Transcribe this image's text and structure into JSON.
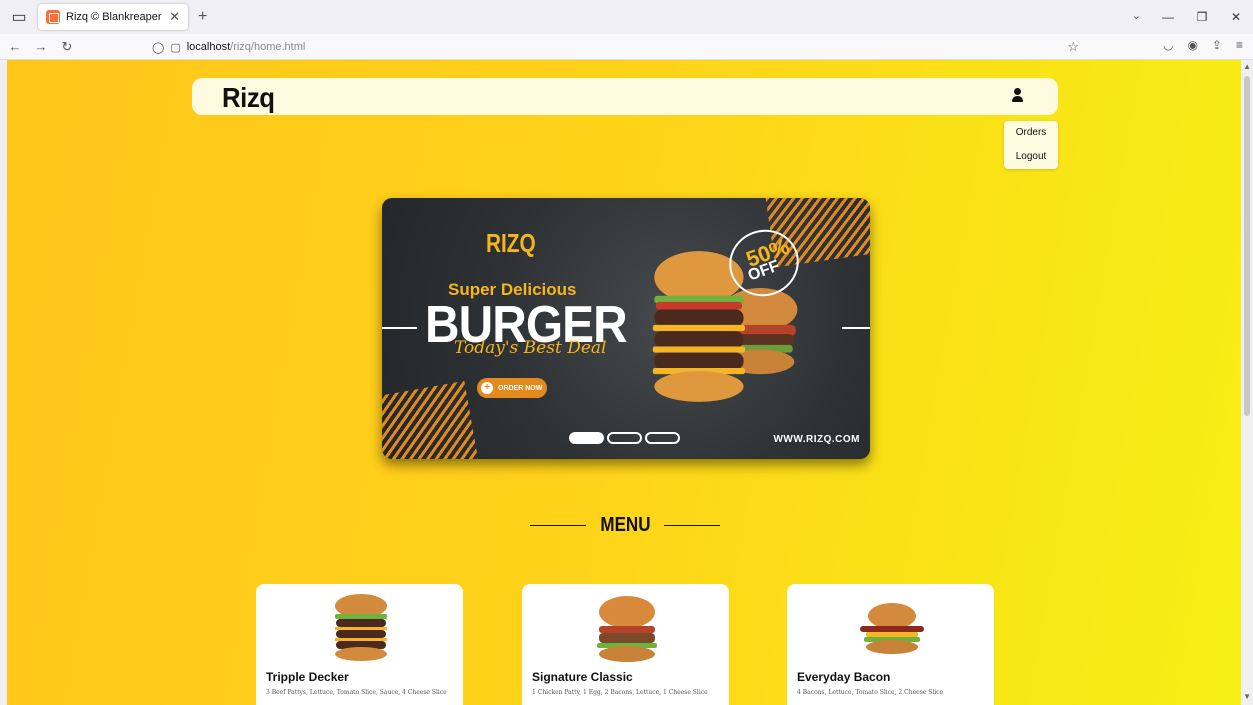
{
  "browser": {
    "tab_title": "Rizq © Blankreaper",
    "url_host": "localhost",
    "url_path": "/rizq/home.html"
  },
  "header": {
    "brand": "Rizq"
  },
  "user_menu": {
    "items": [
      "Orders",
      "Logout"
    ]
  },
  "banner": {
    "logo": "RIZQ",
    "tagline": "Super Delicious",
    "headline": "BURGER",
    "script": "Today's Best Deal",
    "cta": "ORDER NOW",
    "badge_pct": "50%",
    "badge_off": "OFF",
    "website": "WWW.RIZQ.COM",
    "active_slide": 1,
    "slides": 3
  },
  "menu": {
    "heading": "MENU",
    "items": [
      {
        "name": "Tripple Decker",
        "desc": "3 Beef Pattys, Lettuce, Tomato Slice, Sauce, 4 Cheese Slice"
      },
      {
        "name": "Signature Classic",
        "desc": "1 Chicken Patty, 1 Egg, 2 Bacons, Lettuce, 1 Cheese Slice"
      },
      {
        "name": "Everyday Bacon",
        "desc": "4 Bacons, Lettuce, Tomato Slice, 2 Cheese Slice"
      }
    ]
  },
  "colors": {
    "accent": "#e38a1f",
    "brand_yellow": "#f5b51c",
    "page_bg": "#ffd21a"
  }
}
